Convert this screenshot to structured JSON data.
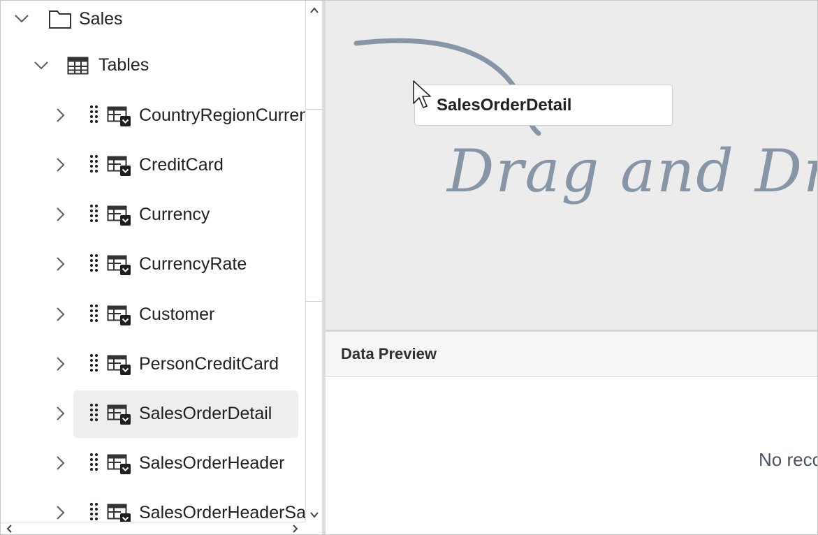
{
  "tree": {
    "root": {
      "label": "Sales",
      "icon": "folder-icon",
      "expanded": true
    },
    "group": {
      "label": "Tables",
      "icon": "table-grid-icon",
      "expanded": true
    },
    "items": [
      {
        "label": "CountryRegionCurrency"
      },
      {
        "label": "CreditCard"
      },
      {
        "label": "Currency"
      },
      {
        "label": "CurrencyRate"
      },
      {
        "label": "Customer"
      },
      {
        "label": "PersonCreditCard"
      },
      {
        "label": "SalesOrderDetail",
        "selected": true
      },
      {
        "label": "SalesOrderHeader"
      },
      {
        "label": "SalesOrderHeaderSalesReason"
      }
    ]
  },
  "canvas": {
    "drag_item_label": "SalesOrderDetail",
    "hint_text": "Drag and Drop",
    "hint_color": "#8696a6"
  },
  "preview": {
    "title": "Data Preview",
    "empty_message": "No records to display"
  }
}
